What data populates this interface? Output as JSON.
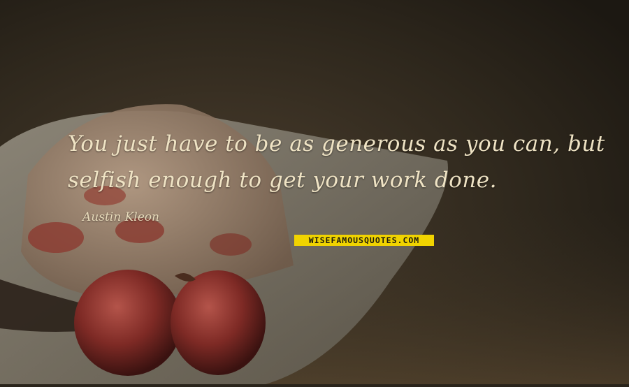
{
  "quote": {
    "line1": "You just have to be as generous as you can, but",
    "line2": "selfish enough to get your work done."
  },
  "author": "Austin Kleon",
  "watermark": "WISEFAMOUSQUOTES.COM",
  "colors": {
    "background": "#2a241b",
    "quote_text": "#efe3c4",
    "badge_bg": "#f0d300",
    "badge_text": "#1c1a0c"
  }
}
